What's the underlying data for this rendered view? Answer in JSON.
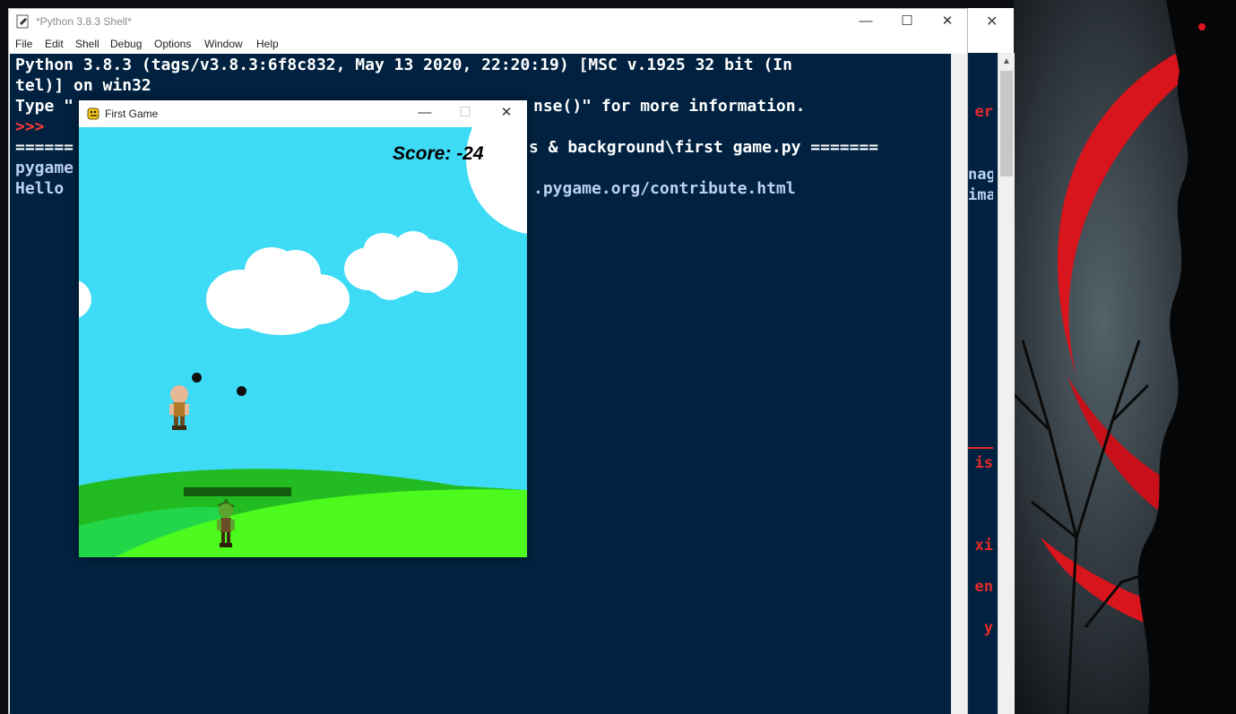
{
  "shell": {
    "title": "*Python 3.8.3 Shell*",
    "menu": [
      "File",
      "Edit",
      "Shell",
      "Debug",
      "Options",
      "Window",
      "Help"
    ],
    "controls": {
      "minimize": "—",
      "maximize": "☐",
      "close": "✕"
    },
    "lines": [
      {
        "text": "Python 3.8.3 (tags/v3.8.3:6f8c832, May 13 2020, 22:20:19) [MSC v.1925 32 bit (In",
        "color": "white"
      },
      {
        "text": "tel)] on win32",
        "color": "white"
      },
      {
        "text": "Type \"",
        "color": "white",
        "suffix": "nse()\" for more information."
      },
      {
        "text": ">>>",
        "color": "red"
      },
      {
        "text": "======",
        "color": "white",
        "suffix": "s & background\\first game.py ======="
      },
      {
        "text": "pygame",
        "color": "blue"
      },
      {
        "text": "Hello ",
        "color": "blue",
        "suffix": ".pygame.org/contribute.html"
      }
    ]
  },
  "background_window": {
    "close": "✕",
    "fragments": [
      {
        "text": "er",
        "color": "red"
      },
      {
        "text": "nag",
        "color": "blue"
      },
      {
        "text": "ima",
        "color": "blue"
      },
      {
        "text": "is",
        "color": "red"
      },
      {
        "text": "xi",
        "color": "red"
      },
      {
        "text": "en",
        "color": "red"
      },
      {
        "text": "y",
        "color": "red"
      }
    ]
  },
  "game": {
    "title": "First Game",
    "controls": {
      "minimize": "—",
      "maximize": "☐",
      "close": "✕"
    },
    "score_label": "Score: -24",
    "enemy_health": 1.0
  },
  "colors": {
    "shell_bg": "#002240",
    "sky": "#3ddbf5",
    "hill_dark": "#22bb22",
    "hill_light": "#4dfa1e",
    "prompt_red": "#ff3a3a"
  }
}
